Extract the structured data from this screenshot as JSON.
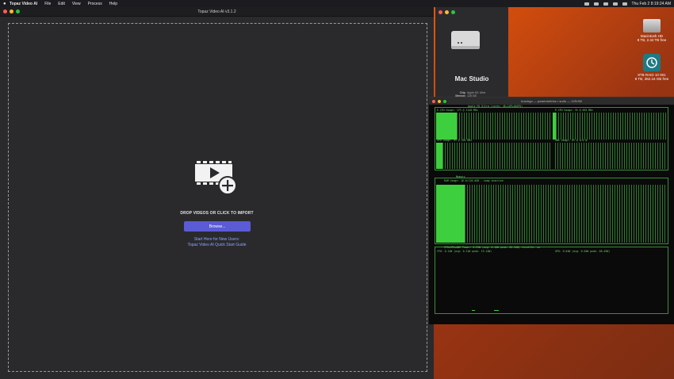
{
  "menubar": {
    "app": "Topaz Video AI",
    "items": [
      "File",
      "Edit",
      "View",
      "Process",
      "Help"
    ],
    "datetime": "Thu Feb 2  8:19:24 AM"
  },
  "topaz": {
    "title": "Topaz Video AI  v3.1.2",
    "drop_label": "DROP VIDEOS OR CLICK TO IMPORT",
    "browse_label": "Browse...",
    "start_line1": "Start Here for New Users:",
    "start_line2": "Topaz Video AI Quick Start Guide"
  },
  "about": {
    "title": "Mac Studio",
    "specs": [
      {
        "key": "Chip",
        "value": "Apple M1 Ultra"
      },
      {
        "key": "Memory",
        "value": "128 GB"
      },
      {
        "key": "Startup disk",
        "value": "Macintosh HD"
      }
    ]
  },
  "desktop": {
    "hd_name": "Macintosh HD",
    "hd_free": "8 TB, 2.42 TB free",
    "raid_name": "8TB RAID 10 001",
    "raid_free": "8 TB, 362.16 GB free"
  },
  "terminal": {
    "title": "brochgo — powermetrics • sudo — 129×58",
    "header": "Apple M1 Ultra (cores: 4E+16P+64GPU)",
    "ecpu": "E-CPU Usage: 17% @ 1140 MHz",
    "pcpu": "P-CPU Usage: 3% @ 663 MHz",
    "gpu": "GPU Usage: 0% @ 434 MHz",
    "ane": "ANE Usage: 0% @ 0.0 W",
    "memory_title": "Memory",
    "ram": "RAM Usage: 16.6/128.0GB - swap inactive",
    "power": "CPU+GPU+ANE Power: 0.29W (avg: 0.16W peak: 82.26W) throttle: no",
    "cpu_power": "CPU: 0.14W (avg: 0.21W peak: 19.14W)",
    "gpu_power": "GPU: 0.04W (avg: 0.04W peak: 68.49W)"
  },
  "colors": {
    "accent": "#5b5bd6",
    "link": "#8ea4ff",
    "terminal_green": "#3ecf3e"
  }
}
